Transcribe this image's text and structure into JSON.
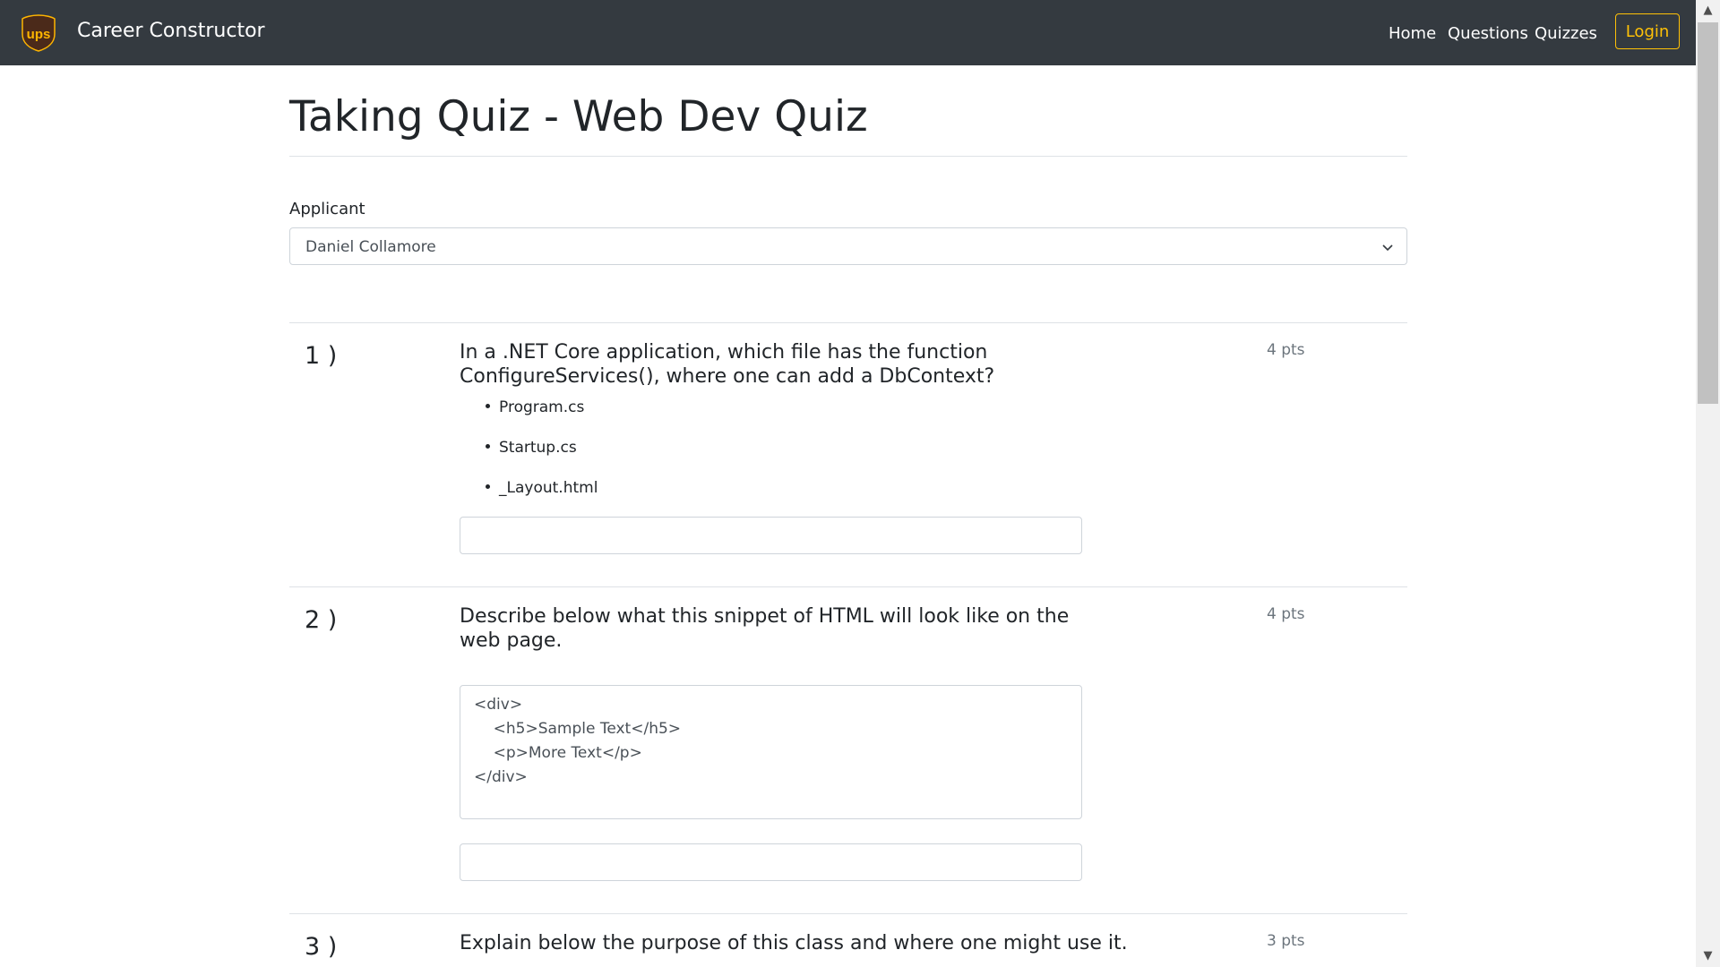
{
  "navbar": {
    "brand": "Career Constructor",
    "logo_text": "ups",
    "links": [
      "Home",
      "Questions",
      "Quizzes"
    ],
    "login_label": "Login"
  },
  "page": {
    "title": "Taking Quiz - Web Dev Quiz"
  },
  "applicant": {
    "label": "Applicant",
    "selected": "Daniel Collamore"
  },
  "questions": [
    {
      "number": "1 )",
      "text": "In a .NET Core application, which file has the function ConfigureServices(), where one can add a DbContext?",
      "points": "4 pts",
      "choices": [
        "Program.cs",
        "Startup.cs",
        "_Layout.html"
      ],
      "answer": ""
    },
    {
      "number": "2 )",
      "text": "Describe below what this snippet of HTML will look like on the web page.",
      "points": "4 pts",
      "code": [
        "<div>",
        "    <h5>Sample Text</h5>",
        "    <p>More Text</p>",
        "</div>"
      ],
      "answer": ""
    },
    {
      "number": "3 )",
      "text": "Explain below the purpose of this class and where one might use it.",
      "points": "3 pts"
    }
  ],
  "colors": {
    "navbar_bg": "#343a40",
    "login_accent": "#ffc107",
    "logo_brown": "#4b2a1a",
    "logo_gold": "#ffb500"
  }
}
